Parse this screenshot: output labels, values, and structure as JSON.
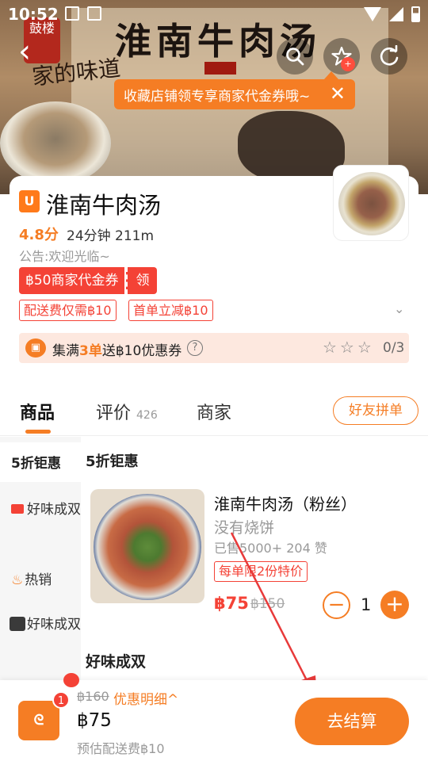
{
  "status_bar": {
    "time": "10:52"
  },
  "banner": {
    "title": "淮南牛肉汤",
    "brush_text": "家的味道",
    "stamp_text": "鼓楼"
  },
  "tooltip": {
    "text": "收藏店铺领专享商家代金券哦~",
    "close": "✕"
  },
  "nav": {
    "back": "‹",
    "star_badge": "+"
  },
  "shop": {
    "logo": "U",
    "name": "淮南牛肉汤",
    "rating": "4.8分",
    "meta": "24分钟 211m",
    "notice": "公告:欢迎光临~",
    "coupon_amount": "฿50商家代金券",
    "coupon_action": "领",
    "tag_delivery": "配送费仅需฿10",
    "tag_first": "首单立减฿10",
    "expand": "⌄",
    "promo_prefix": "集满",
    "promo_count": "3单",
    "promo_suffix": "送฿10优惠券",
    "promo_help": "?",
    "promo_stars": "☆☆☆",
    "promo_progress": "0/3"
  },
  "tabs": {
    "goods": "商品",
    "reviews": "评价",
    "reviews_count": "426",
    "merchant": "商家",
    "group_buy": "好友拼单"
  },
  "sidebar": {
    "items": [
      {
        "label": "5折钜惠"
      },
      {
        "label": "好味成双"
      },
      {
        "label": "热销"
      },
      {
        "label": "好味成双"
      }
    ]
  },
  "section": {
    "title": "5折钜惠",
    "title2": "好味成双"
  },
  "product": {
    "name": "淮南牛肉汤（粉丝）",
    "subtitle": "没有烧饼",
    "sold": "已售5000+ 204 赞",
    "limit": "每单限2份特价",
    "price": "฿75",
    "original": "฿150",
    "qty": "1",
    "minus": "−",
    "plus": "+"
  },
  "bottom": {
    "cart_badge": "1",
    "original_total": "฿160",
    "detail": "优惠明细^",
    "total": "฿75",
    "fee": "预估配送费฿10",
    "checkout": "去结算"
  },
  "colors": {
    "accent": "#f57d24",
    "red": "#f44236"
  }
}
